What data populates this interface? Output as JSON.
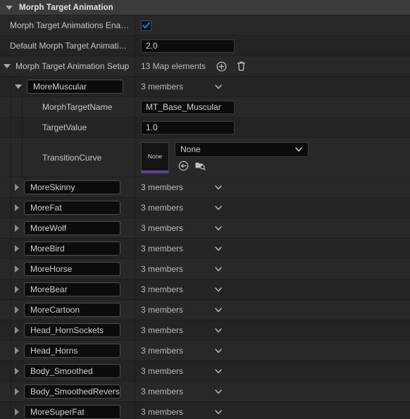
{
  "header": {
    "title": "Morph Target Animation",
    "expanded_icon": "triangle-down-icon"
  },
  "properties": {
    "enabled": {
      "label": "Morph Target Animations Enabl…",
      "checked": true,
      "checkbox_color": "#0a7cf0"
    },
    "default_duration": {
      "label": "Default Morph Target Animatio…",
      "value": "2.0"
    },
    "setup": {
      "label": "Morph Target Animation Setup",
      "summary": "13 Map elements",
      "add_icon": "circle-plus-icon",
      "delete_icon": "trash-icon"
    }
  },
  "expanded_entry": {
    "key": "MoreMuscular",
    "members_label": "3 members",
    "fields": {
      "morph_target_name": {
        "label": "MorphTargetName",
        "value": "MT_Base_Muscular"
      },
      "target_value": {
        "label": "TargetValue",
        "value": "1.0"
      },
      "transition_curve": {
        "label": "TransitionCurve",
        "thumbnail_text": "None",
        "combo_value": "None",
        "accent_color": "#5d3fa0",
        "use_selected_icon": "use-selected-asset-icon",
        "browse_icon": "browse-to-asset-icon"
      }
    }
  },
  "collapsed_entries": [
    {
      "key": "MoreSkinny",
      "members_label": "3 members"
    },
    {
      "key": "MoreFat",
      "members_label": "3 members"
    },
    {
      "key": "MoreWolf",
      "members_label": "3 members"
    },
    {
      "key": "MoreBird",
      "members_label": "3 members"
    },
    {
      "key": "MoreHorse",
      "members_label": "3 members"
    },
    {
      "key": "MoreBear",
      "members_label": "3 members"
    },
    {
      "key": "MoreCartoon",
      "members_label": "3 members"
    },
    {
      "key": "Head_HornSockets",
      "members_label": "3 members"
    },
    {
      "key": "Head_Horns",
      "members_label": "3 members"
    },
    {
      "key": "Body_Smoothed",
      "members_label": "3 members"
    },
    {
      "key": "Body_SmoothedReversed",
      "members_label": "3 members"
    },
    {
      "key": "MoreSuperFat",
      "members_label": "3 members"
    }
  ]
}
